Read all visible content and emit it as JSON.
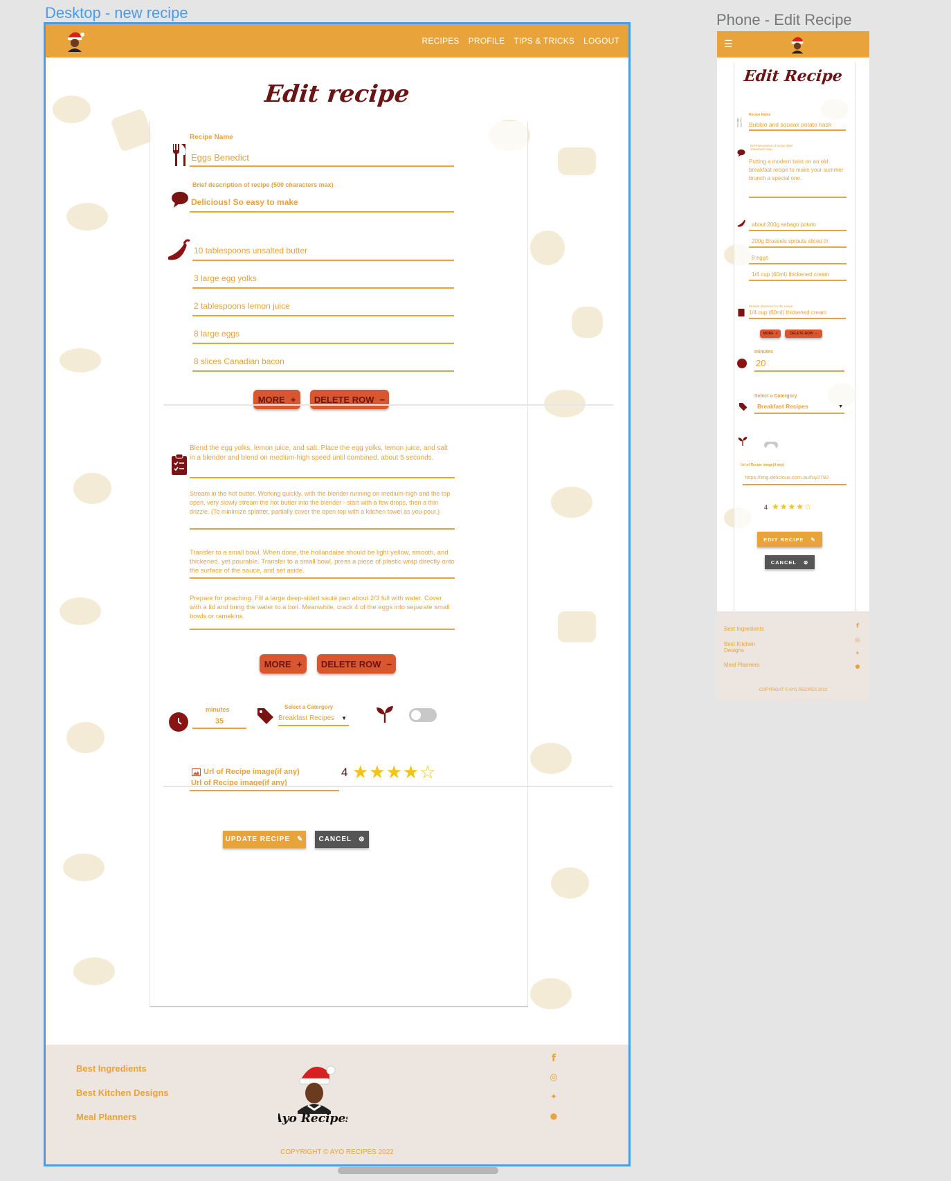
{
  "canvas": {
    "desktop_label": "Desktop - new recipe",
    "phone_label": "Phone - Edit Recipe"
  },
  "colors": {
    "accent": "#e8a33a",
    "brand_dark": "#6b1414",
    "button_red": "#d9572e",
    "cancel_gray": "#555555",
    "footer_bg": "#ede5df",
    "frame_blue": "#4a9be8"
  },
  "desktop": {
    "nav": [
      "RECIPES",
      "PROFILE",
      "TIPS & TRICKS",
      "LOGOUT"
    ],
    "title": "Edit recipe",
    "recipe_name_label": "Recipe Name",
    "recipe_name": "Eggs Benedict",
    "description_label": "Brief description of recipe (500 characters max)",
    "description": "Delicious! So easy to make",
    "ingredients": [
      "10 tablespoons unsalted butter",
      "3 large egg yolks",
      "2 tablespoons lemon juice",
      "8 large eggs",
      "8 slices Canadian bacon"
    ],
    "more_label": "MORE",
    "more_symbol": "+",
    "delete_label": "DELETE ROW",
    "delete_symbol": "−",
    "steps": [
      "Blend the egg yolks, lemon juice, and salt. Place the egg yolks, lemon juice, and salt in a blender and blend on medium-high speed until combined, about 5 seconds.",
      "Stream in the hot butter. Working quickly, with the blender running on medium-high and the top open, very slowly stream the hot butter into the blender - start with a few drops, then a thin drizzle. (To minimize splatter, partially cover the open top with a kitchen towel as you pour.)",
      "Transfer to a small bowl. When done, the hollandaise should be light yellow, smooth, and thickened, yet pourable. Transfer to a small bowl, press a piece of plastic wrap directly onto the surface of the sauce, and set aside.",
      "Prepare for poaching. Fill a large deep-sided sauté pan about 2/3 full with water. Cover with a lid and bring the water to a boil. Meanwhile, crack 4 of the eggs into separate small bowls or ramekins."
    ],
    "minutes_label": "minutes",
    "minutes": "35",
    "category_label": "Select a Catergory",
    "category": "Breakfast Recipes",
    "url_label": "Url of Recipe image(if any)",
    "url_value": "Url of Recipe image(if any)",
    "rating": 4,
    "rating_text": "4",
    "stars": "★★★★",
    "star_empty": "☆",
    "update_label": "UPDATE RECIPE",
    "cancel_label": "CANCEL",
    "footer_links": [
      "Best Ingredients",
      "Best Kitchen Designs",
      "Meal Planners"
    ],
    "social_icons": [
      "facebook-icon",
      "instagram-icon",
      "twitter-icon",
      "github-icon"
    ],
    "copyright": "COPYRIGHT © AYO RECIPES 2022"
  },
  "phone": {
    "title": "Edit Recipe",
    "recipe_name_label": "Recipe Name",
    "recipe_name": "Bubble and squeak potato hash",
    "description_label": "Brief description of recipe (500 characters max)",
    "description": "Putting a modern twist on an old breakfast recipe to make your summer brunch a special one.",
    "ingredients": [
      "about 200g sebago potato",
      "200g Brussels sprouts sliced th",
      "8 eggs",
      "1/4 cup (60ml) thickened cream"
    ],
    "method_label": "Provide directions for the recipe",
    "method": "1/4 cup (60ml) thickened cream",
    "more_label": "MORE",
    "more_symbol": "+",
    "delete_label": "DELETE ROW",
    "delete_symbol": "−",
    "minutes_label": "minutes",
    "minutes": "20",
    "category_label": "Select a Catergory",
    "category": "Breakfast Recipes",
    "url_label": "Url of Recipe image(if any)",
    "url_value": "https://img.delicious.com.au/fuy2792",
    "rating": 4,
    "rating_text": "4",
    "stars": "★★★★",
    "star_empty": "☆",
    "edit_label": "EDIT RECIPE",
    "cancel_label": "CANCEL",
    "footer_links": [
      "Best Ingredients",
      "Best Kitchen Designs",
      "Meal Planners"
    ],
    "copyright": "COPYRIGHT © AYO RECIPES 2022"
  }
}
